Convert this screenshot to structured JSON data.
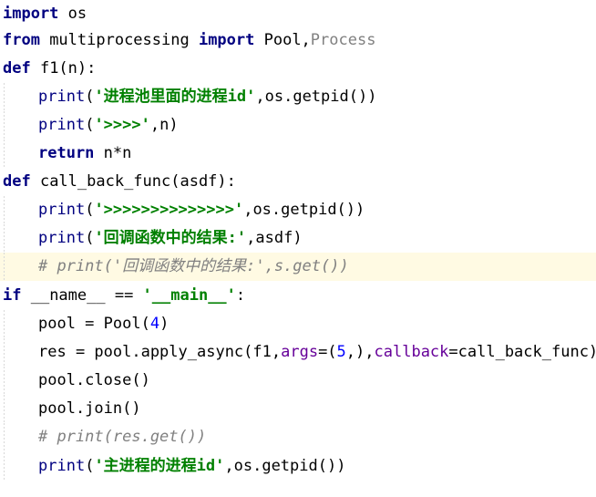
{
  "code": {
    "line_01": {
      "kw": "import",
      "rest": " os"
    },
    "line_02": {
      "kw1": "from",
      "mod": " multiprocessing ",
      "kw2": "import",
      "name1": " Pool,",
      "name2": "Process"
    },
    "line_03": {
      "kw": "def",
      "rest": " f1(n):"
    },
    "line_04": {
      "fn": "print",
      "open": "(",
      "str": "'进程池里面的进程id'",
      "rest": ",os.getpid())"
    },
    "line_05": {
      "fn": "print",
      "open": "(",
      "str": "'>>>>'",
      "rest": ",n)"
    },
    "line_06": {
      "kw": "return",
      "rest": " n*n"
    },
    "line_07": {
      "kw": "def",
      "rest": " call_back_func(asdf):"
    },
    "line_08": {
      "fn": "print",
      "open": "(",
      "str": "'>>>>>>>>>>>>>>'",
      "rest": ",os.getpid())"
    },
    "line_09": {
      "fn": "print",
      "open": "(",
      "str": "'回调函数中的结果:'",
      "rest": ",asdf)"
    },
    "line_10": {
      "comment": "# print('回调函数中的结果:',s.get())"
    },
    "line_11": {
      "kw": "if",
      "mid": " __name__ == ",
      "str": "'__main__'",
      "rest": ":"
    },
    "line_12": {
      "pre": "pool = Pool(",
      "num": "4",
      "post": ")"
    },
    "line_13": {
      "pre": "res = pool.apply_async(f1,",
      "p1": "args",
      "mid1": "=(",
      "num": "5",
      "mid2": ",),",
      "p2": "callback",
      "post": "=call_back_func)"
    },
    "line_14": {
      "text": "pool.close()"
    },
    "line_15": {
      "text": "pool.join()"
    },
    "line_16": {
      "comment": "# print(res.get())"
    },
    "line_17": {
      "fn": "print",
      "open": "(",
      "str": "'主进程的进程id'",
      "rest": ",os.getpid())"
    }
  }
}
